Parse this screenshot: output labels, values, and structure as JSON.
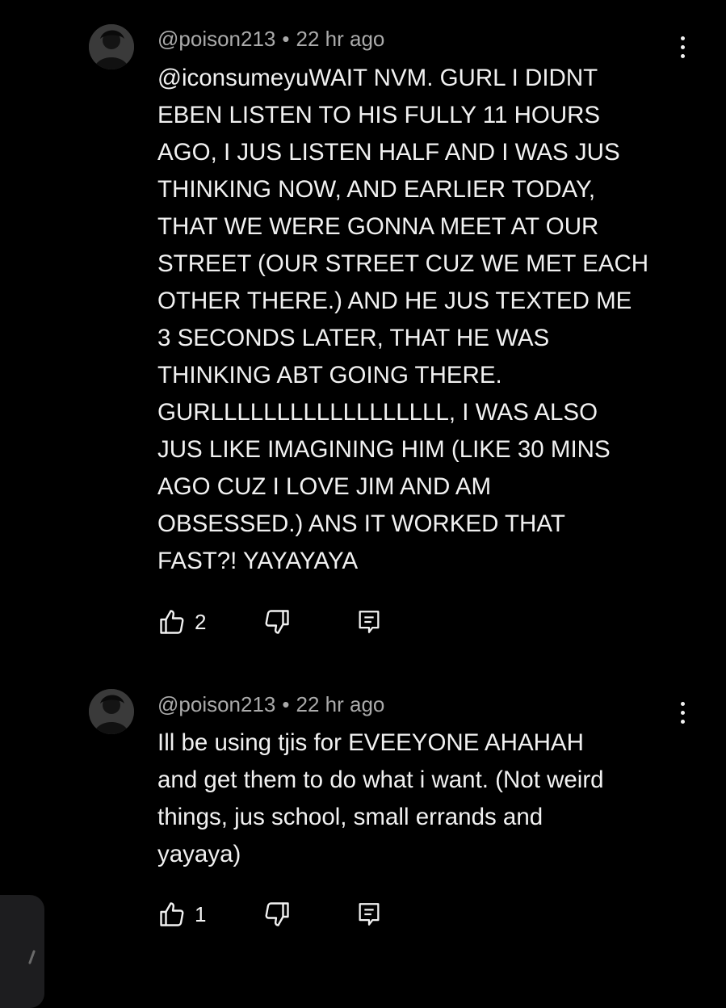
{
  "comments": [
    {
      "username": "@poison213",
      "separator": "•",
      "time": "22 hr ago",
      "text": "@iconsumeyuWAIT NVM. GURL I DIDNT\nEBEN LISTEN TO HIS FULLY 11 HOURS\nAGO, I JUS LISTEN HALF AND I WAS JUS\nTHINKING NOW, AND EARLIER TODAY,\nTHAT WE WERE GONNA MEET AT OUR\nSTREET (OUR STREET CUZ WE MET EACH\nOTHER THERE.) AND HE JUS TEXTED ME\n3 SECONDS LATER, THAT HE WAS\nTHINKING ABT GOING THERE.\nGURLLLLLLLLLLLLLLLLLL, I WAS ALSO\nJUS LIKE IMAGINING HIM (LIKE 30 MINS\nAGO CUZ I LOVE JIM AND AM\nOBSESSED.) ANS IT WORKED THAT\nFAST?! YAYAYAYA",
      "likes": "2",
      "avatar_icon": "user-avatar-icon",
      "more_icon": "vertical-ellipsis-icon",
      "like_icon": "thumbs-up-icon",
      "dislike_icon": "thumbs-down-icon",
      "reply_icon": "reply-comment-icon"
    },
    {
      "username": "@poison213",
      "separator": "•",
      "time": "22 hr ago",
      "text": "Ill be using tjis for EVEEYONE AHAHAH\nand get them to do what i want. (Not weird\nthings, jus school, small errands and\nyayaya)",
      "likes": "1",
      "avatar_icon": "user-avatar-icon",
      "more_icon": "vertical-ellipsis-icon",
      "like_icon": "thumbs-up-icon",
      "dislike_icon": "thumbs-down-icon",
      "reply_icon": "reply-comment-icon"
    }
  ],
  "colors": {
    "background": "#000000",
    "text": "#f1f1f1",
    "meta": "#aaaaaa"
  }
}
